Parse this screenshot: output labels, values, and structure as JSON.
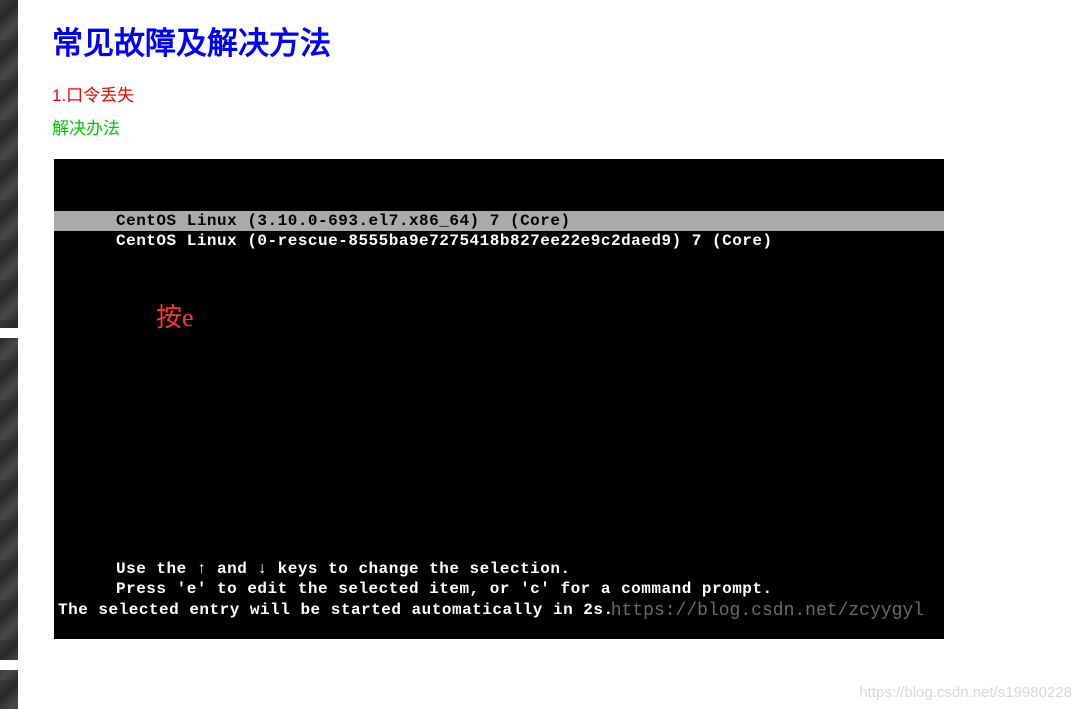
{
  "heading": "常见故障及解决方法",
  "problem": {
    "title": "1.口令丢失",
    "solution_label": "解决办法"
  },
  "terminal": {
    "menu": {
      "selected": "CentOS Linux (3.10.0-693.el7.x86_64) 7 (Core)",
      "other": "CentOS Linux (0-rescue-8555ba9e7275418b827ee22e9c2daed9) 7 (Core)"
    },
    "annotation": "按e",
    "help": {
      "line1": "Use the ↑ and ↓ keys to change the selection.",
      "line2": "Press 'e' to edit the selected item, or 'c' for a command prompt.",
      "line3": "The selected entry will be started automatically in 2s."
    },
    "watermark_inner": "https://blog.csdn.net/zcyygyl"
  },
  "watermark_outer": "https://blog.csdn.net/s19980228"
}
